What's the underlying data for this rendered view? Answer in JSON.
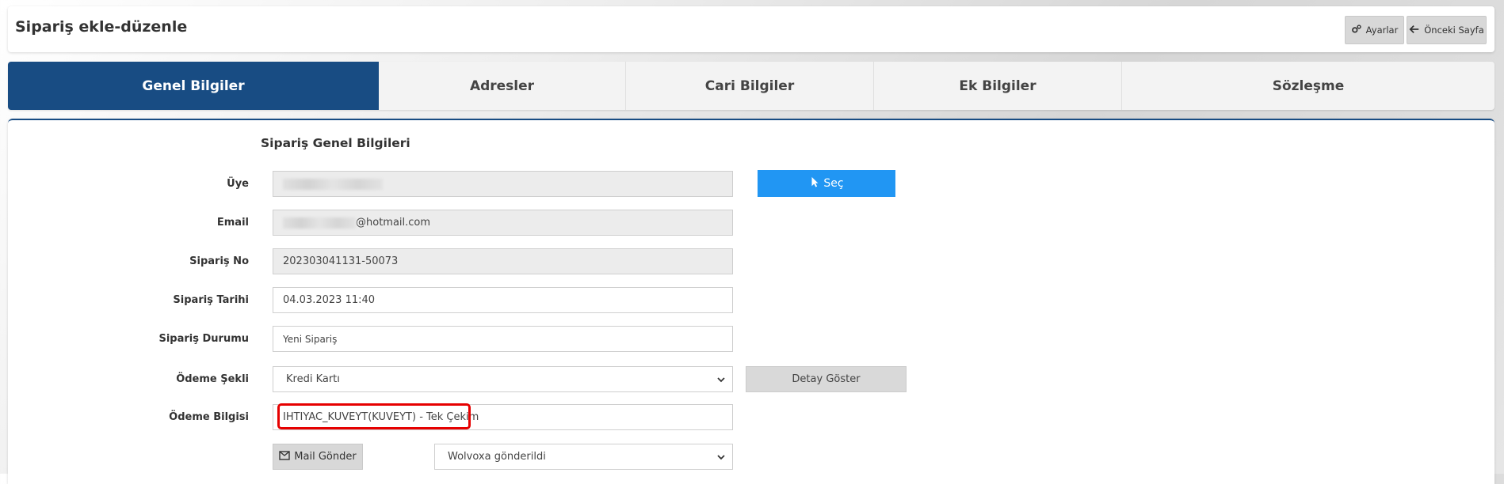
{
  "header": {
    "title": "Sipariş ekle-düzenle",
    "settings_label": "Ayarlar",
    "prev_page_label": "Önceki Sayfa"
  },
  "tabs": [
    {
      "label": "Genel Bilgiler",
      "active": true
    },
    {
      "label": "Adresler",
      "active": false
    },
    {
      "label": "Cari Bilgiler",
      "active": false
    },
    {
      "label": "Ek Bilgiler",
      "active": false
    },
    {
      "label": "Sözleşme",
      "active": false
    }
  ],
  "form": {
    "section_title": "Sipariş Genel Bilgileri",
    "member": {
      "label": "Üye",
      "value": ""
    },
    "select_button": "Seç",
    "email": {
      "label": "Email",
      "visible_suffix": "@hotmail.com"
    },
    "order_no": {
      "label": "Sipariş No",
      "value": "202303041131-50073"
    },
    "order_date": {
      "label": "Sipariş Tarihi",
      "value": "04.03.2023 11:40"
    },
    "order_status": {
      "label": "Sipariş Durumu",
      "value": "Yeni Sipariş"
    },
    "payment_method": {
      "label": "Ödeme Şekli",
      "selected": "Kredi Kartı"
    },
    "detail_button": "Detay Göster",
    "payment_info": {
      "label": "Ödeme Bilgisi",
      "value": "IHTIYAC_KUVEYT(KUVEYT) - Tek Çekim"
    },
    "mail_button": "Mail Gönder",
    "wolvoxa_status": {
      "selected": "Wolvoxa gönderildi"
    }
  },
  "colors": {
    "primary": "#184c83",
    "accent_button": "#2196f3",
    "highlight": "#e60000"
  }
}
